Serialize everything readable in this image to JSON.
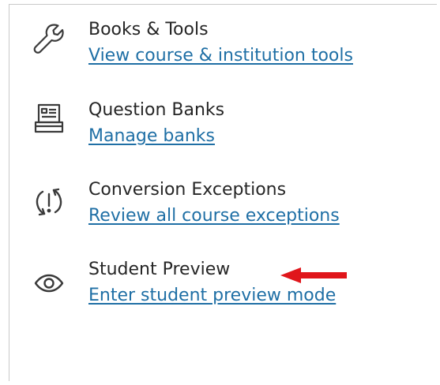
{
  "tools": [
    {
      "icon": "wrench-icon",
      "title": "Books & Tools",
      "link": "View course & institution tools"
    },
    {
      "icon": "question-bank-icon",
      "title": "Question Banks",
      "link": "Manage banks"
    },
    {
      "icon": "conversion-exceptions-icon",
      "title": "Conversion Exceptions",
      "link": "Review all course exceptions"
    },
    {
      "icon": "eye-icon",
      "title": "Student Preview",
      "link": "Enter student preview mode"
    }
  ],
  "colors": {
    "link": "#1f6fa5",
    "title": "#262626",
    "icon": "#3a3a3a",
    "annotation_arrow": "#e0161b"
  },
  "annotation": {
    "icon": "red-arrow-icon"
  }
}
